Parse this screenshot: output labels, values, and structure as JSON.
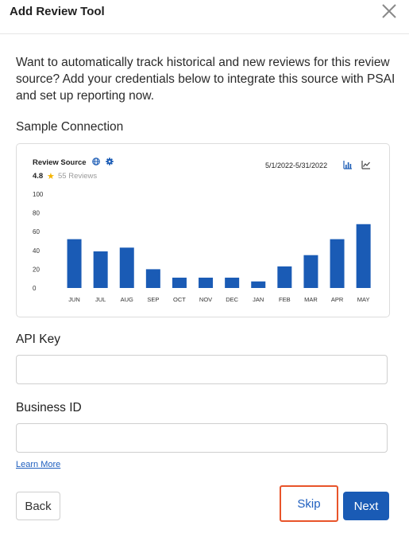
{
  "header": {
    "title": "Add Review Tool",
    "close_icon": "close-icon"
  },
  "intro_text": "Want to automatically track historical and new reviews for this review source? Add your credentials below to integrate this source with PSAI and set up reporting now.",
  "sample_label": "Sample Connection",
  "sample_card": {
    "source_title": "Review Source",
    "rating": "4.8",
    "reviews": "55 Reviews",
    "date_range": "5/1/2022-5/31/2022",
    "icons": [
      "globe-icon",
      "gear-icon",
      "bar-chart-icon",
      "line-chart-icon"
    ]
  },
  "chart_data": {
    "type": "bar",
    "categories": [
      "JUN",
      "JUL",
      "AUG",
      "SEP",
      "OCT",
      "NOV",
      "DEC",
      "JAN",
      "FEB",
      "MAR",
      "APR",
      "MAY"
    ],
    "values": [
      52,
      39,
      43,
      20,
      11,
      11,
      11,
      7,
      23,
      35,
      52,
      68
    ],
    "yticks": [
      0,
      20,
      40,
      60,
      80,
      100
    ],
    "ylim": [
      0,
      100
    ],
    "bar_color": "#1a5bb5",
    "grid": false
  },
  "fields": {
    "api_key": {
      "label": "API Key",
      "value": "",
      "placeholder": ""
    },
    "business_id": {
      "label": "Business ID",
      "value": "",
      "placeholder": ""
    }
  },
  "learn_more": "Learn More",
  "buttons": {
    "back": "Back",
    "skip": "Skip",
    "next": "Next"
  },
  "colors": {
    "primary": "#1a5bb5",
    "highlight": "#e8542a",
    "star": "#f5b400"
  }
}
